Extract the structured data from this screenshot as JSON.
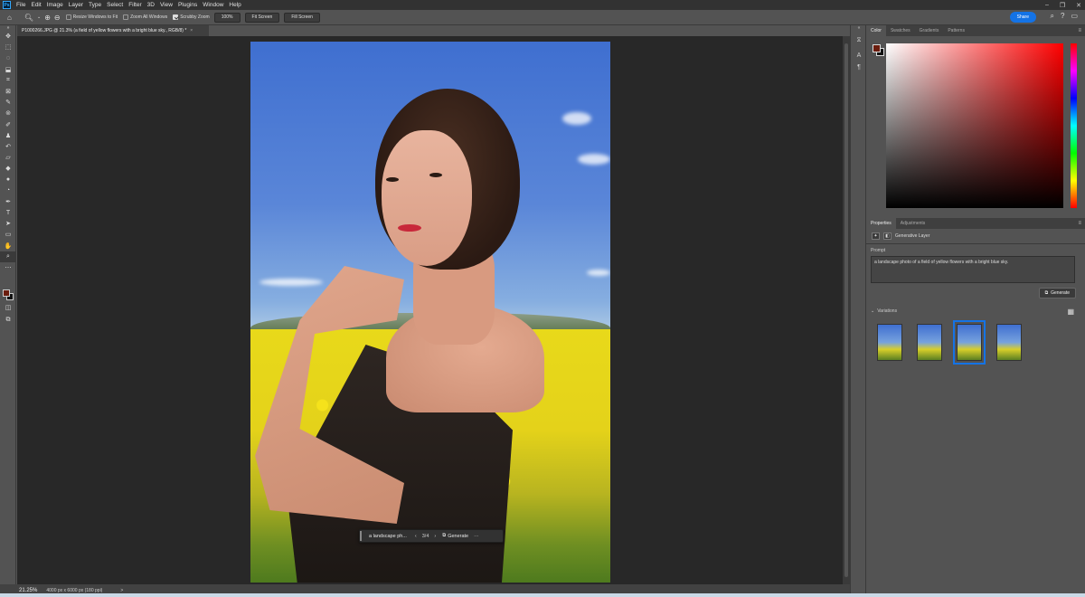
{
  "menubar": {
    "logo": "Ps",
    "items": [
      "File",
      "Edit",
      "Image",
      "Layer",
      "Type",
      "Select",
      "Filter",
      "3D",
      "View",
      "Plugins",
      "Window",
      "Help"
    ]
  },
  "options": {
    "resize_windows": "Resize Windows to Fit",
    "zoom_all": "Zoom All Windows",
    "scrubby": "Scrubby Zoom",
    "zoom100": "100%",
    "fit_screen": "Fit Screen",
    "fill_screen": "Fill Screen",
    "share": "Share"
  },
  "document": {
    "tab_title": "P1000266.JPG @ 21.3% (a field of yellow flowers with a bright blue sky., RGB/8) *",
    "close": "×"
  },
  "context_bar": {
    "prompt": "a landscape ph...",
    "counter": "3/4",
    "generate": "Generate",
    "more": "···"
  },
  "status": {
    "zoom": "21.25%",
    "dimensions": "4000 px x 6000 px (180 ppi)",
    "arrow": ">"
  },
  "color_panel": {
    "tabs": [
      "Color",
      "Swatches",
      "Gradients",
      "Patterns"
    ],
    "fg_color": "#6b1d0e",
    "bg_color": "#111111"
  },
  "properties_panel": {
    "tabs": [
      "Properties",
      "Adjustments"
    ],
    "layer_type": "Generative Layer",
    "prompt_label": "Prompt",
    "prompt_text": "a landscape photo of a field of yellow flowers with a bright blue sky.",
    "generate": "Generate",
    "variations_label": "Variations",
    "variations_count": 4,
    "selected_variation": 3
  }
}
